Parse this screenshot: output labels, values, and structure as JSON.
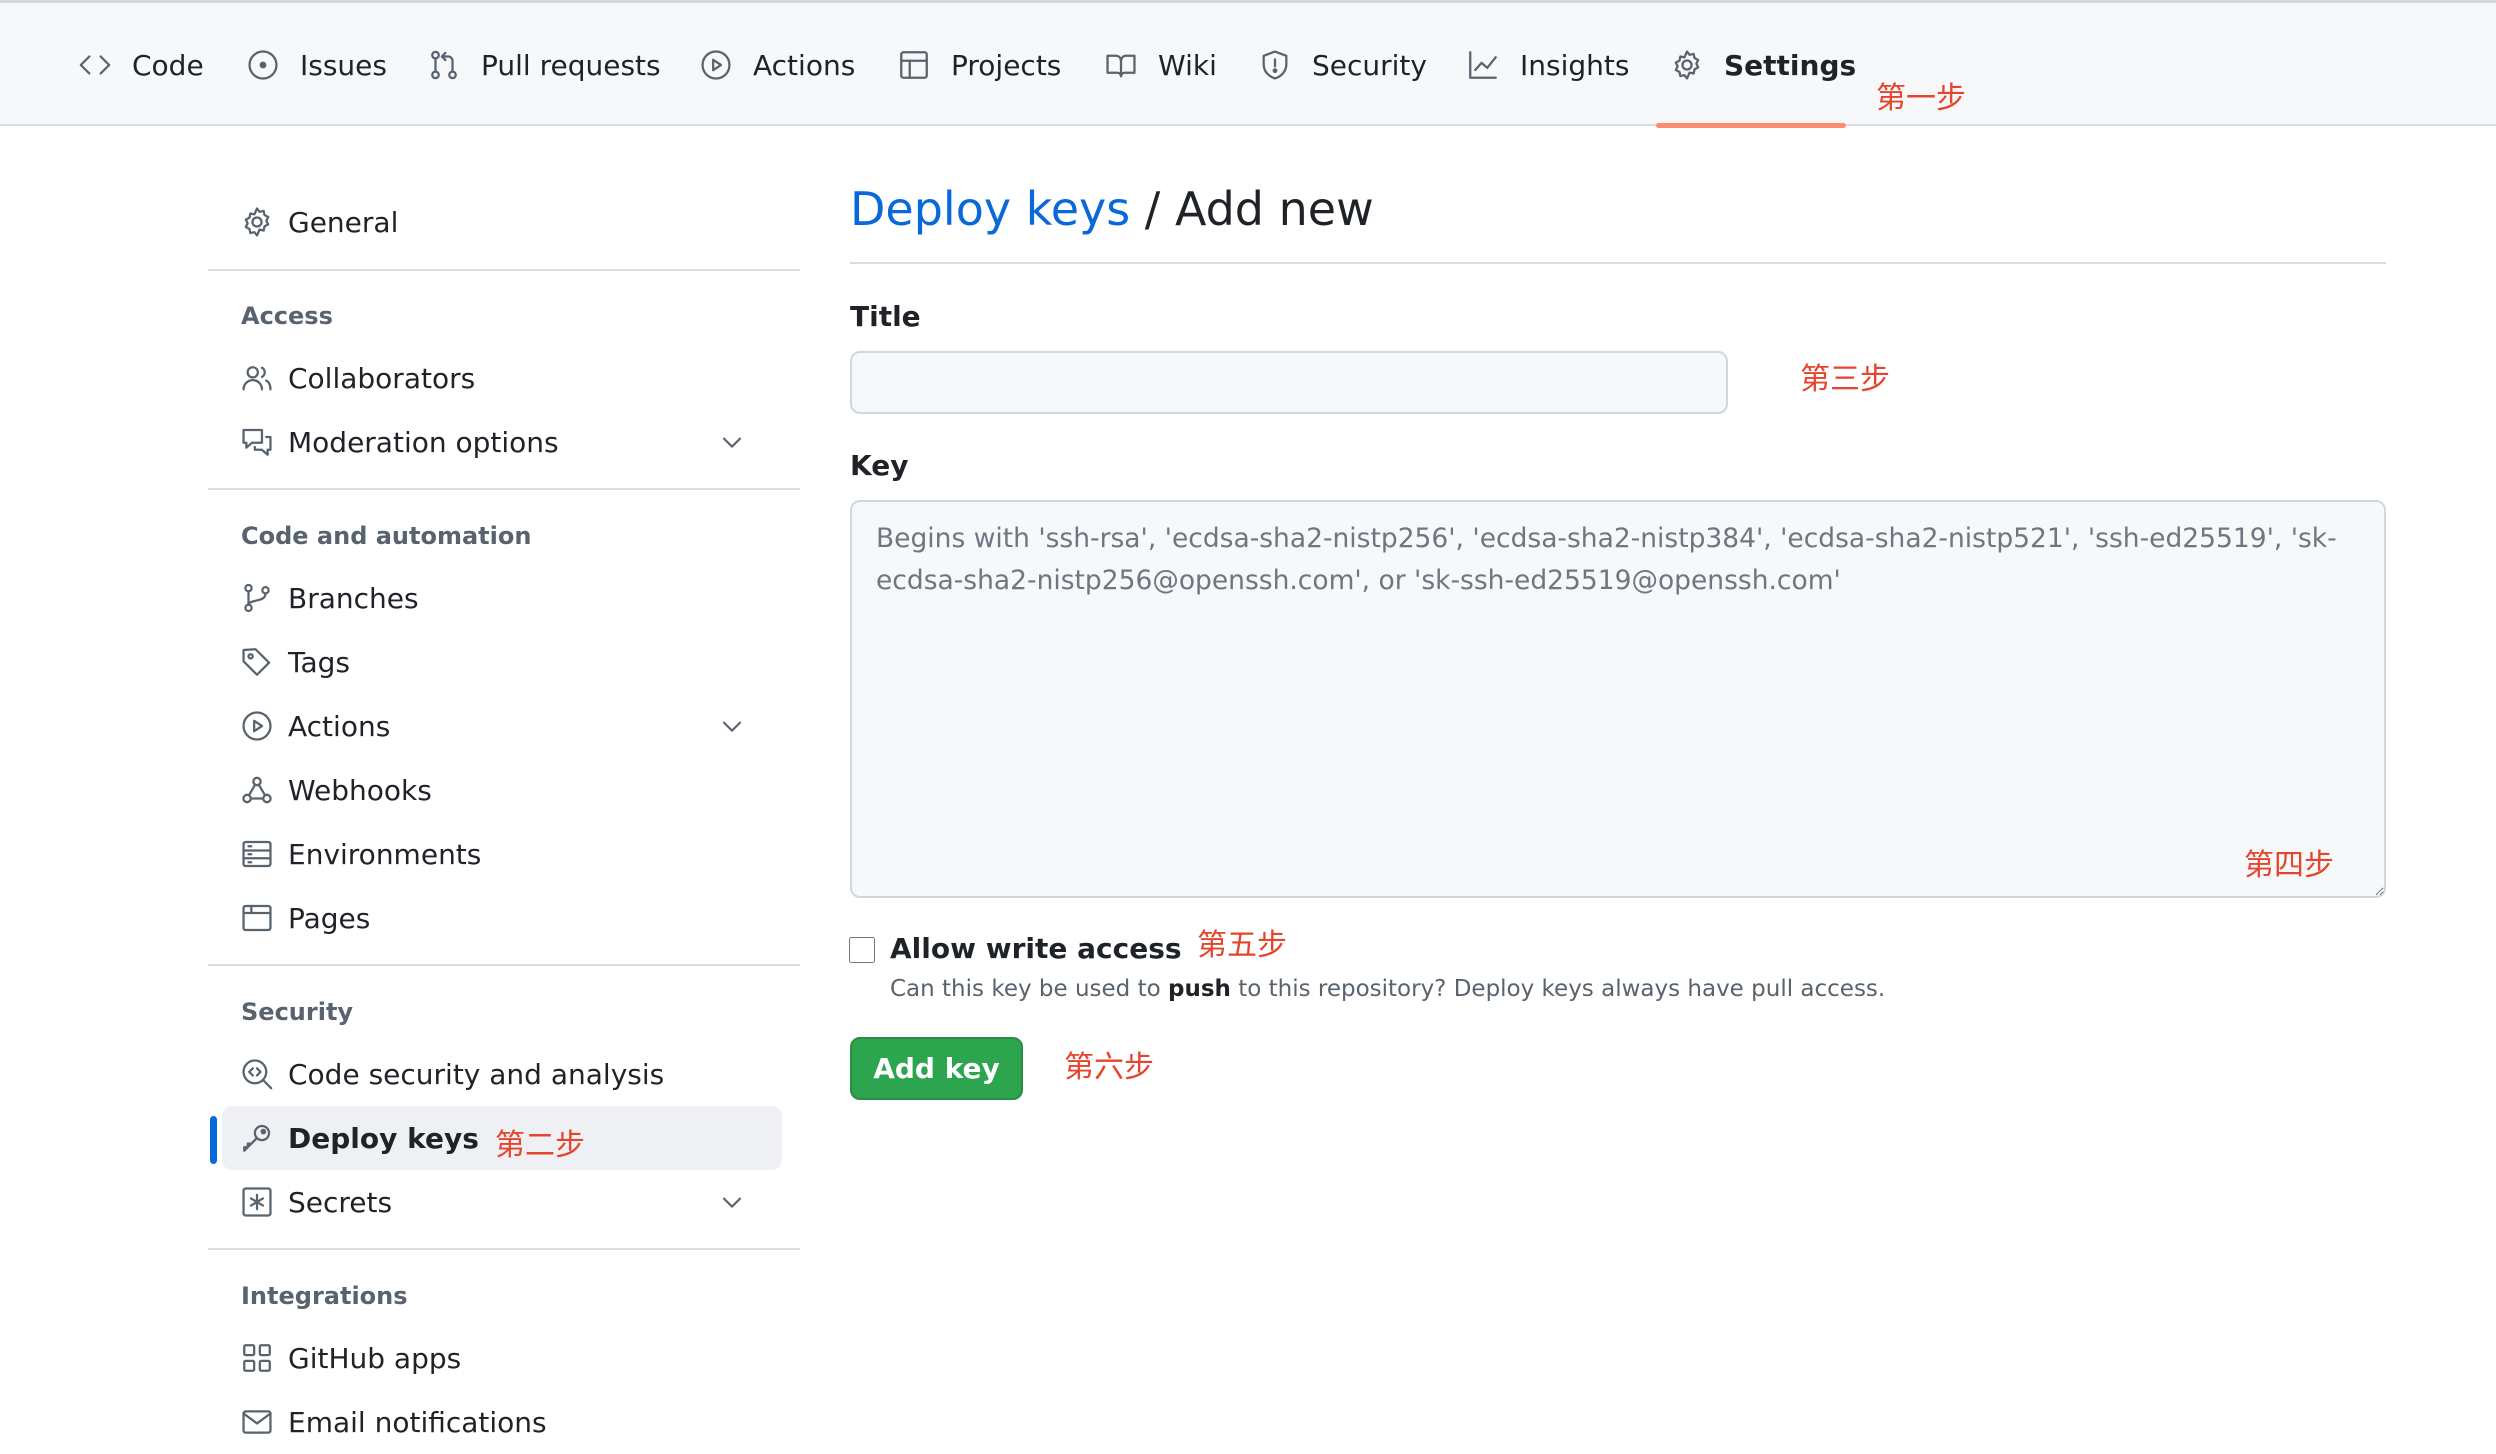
{
  "tabs": [
    {
      "label": "Code",
      "icon": "code-icon"
    },
    {
      "label": "Issues",
      "icon": "issue-opened-icon"
    },
    {
      "label": "Pull requests",
      "icon": "git-pull-request-icon"
    },
    {
      "label": "Actions",
      "icon": "play-icon"
    },
    {
      "label": "Projects",
      "icon": "table-icon"
    },
    {
      "label": "Wiki",
      "icon": "book-icon"
    },
    {
      "label": "Security",
      "icon": "shield-icon"
    },
    {
      "label": "Insights",
      "icon": "graph-icon"
    },
    {
      "label": "Settings",
      "icon": "gear-icon",
      "selected": true
    }
  ],
  "annotations": {
    "step1": "第一步",
    "step2": "第二步",
    "step3": "第三步",
    "step4": "第四步",
    "step5": "第五步",
    "step6": "第六步"
  },
  "sidebar": {
    "general": {
      "label": "General",
      "icon": "gear-icon"
    },
    "sections": [
      {
        "heading": "Access",
        "items": [
          {
            "label": "Collaborators",
            "icon": "people-icon"
          },
          {
            "label": "Moderation options",
            "icon": "comment-discussion-icon",
            "expandable": true
          }
        ]
      },
      {
        "heading": "Code and automation",
        "items": [
          {
            "label": "Branches",
            "icon": "git-branch-icon"
          },
          {
            "label": "Tags",
            "icon": "tag-icon"
          },
          {
            "label": "Actions",
            "icon": "play-icon",
            "expandable": true
          },
          {
            "label": "Webhooks",
            "icon": "webhook-icon"
          },
          {
            "label": "Environments",
            "icon": "server-icon"
          },
          {
            "label": "Pages",
            "icon": "browser-icon"
          }
        ]
      },
      {
        "heading": "Security",
        "items": [
          {
            "label": "Code security and analysis",
            "icon": "codescan-icon"
          },
          {
            "label": "Deploy keys",
            "icon": "key-icon",
            "active": true
          },
          {
            "label": "Secrets",
            "icon": "key-asterisk-icon",
            "expandable": true
          }
        ]
      },
      {
        "heading": "Integrations",
        "items": [
          {
            "label": "GitHub apps",
            "icon": "apps-icon"
          },
          {
            "label": "Email notifications",
            "icon": "mail-icon"
          }
        ]
      }
    ]
  },
  "main": {
    "breadcrumb_link": "Deploy keys",
    "breadcrumb_sep": " / ",
    "heading": "Add new",
    "title_label": "Title",
    "title_value": "",
    "key_label": "Key",
    "key_placeholder": "Begins with 'ssh-rsa', 'ecdsa-sha2-nistp256', 'ecdsa-sha2-nistp384', 'ecdsa-sha2-nistp521', 'ssh-ed25519', 'sk-ecdsa-sha2-nistp256@openssh.com', or 'sk-ssh-ed25519@openssh.com'",
    "write_access_label": "Allow write access",
    "write_access_checked": false,
    "write_help_before": "Can this key be used to ",
    "write_help_bold": "push",
    "write_help_after": " to this repository? Deploy keys always have pull access.",
    "submit_label": "Add key"
  },
  "colors": {
    "link": "#0969da",
    "annotation": "#e5442d",
    "primary_button": "#2da44e",
    "tab_underline": "#fd8c73",
    "active_marker": "#0969da"
  }
}
